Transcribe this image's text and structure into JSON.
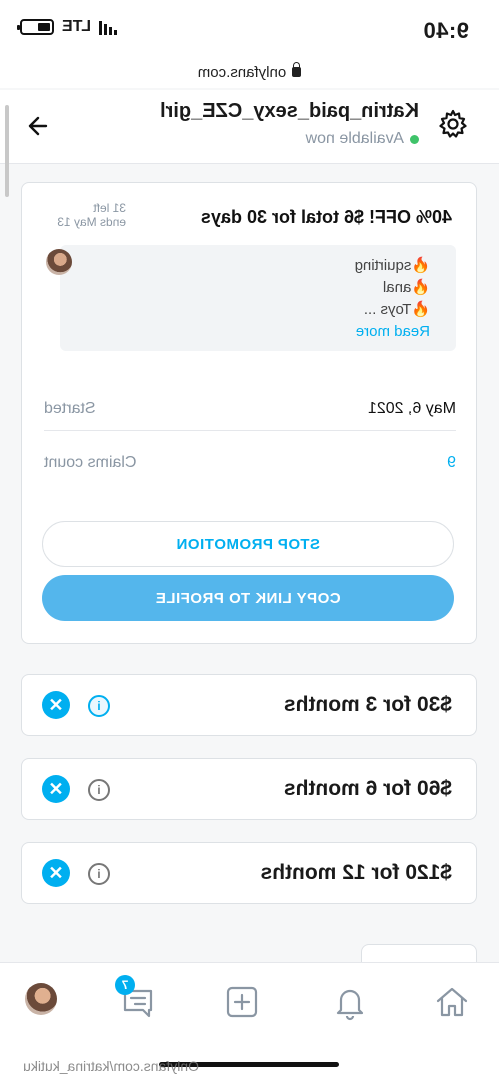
{
  "status_bar": {
    "time": "9:40",
    "network": "LTE"
  },
  "browser": {
    "url": "onlyfans.com"
  },
  "chat_header": {
    "name": "Katrin_paid_sexy_CZE_girl",
    "status": "Available now"
  },
  "promotion": {
    "title": "40% OFF! $6 total for 30 days",
    "left": "31 left",
    "ends": "ends May 13",
    "description": [
      "🔥squirting",
      "🔥anal",
      "🔥Toys ..."
    ],
    "read_more": "Read more",
    "started_label": "Started",
    "started_value": "May 6, 2021",
    "claims_label": "Claims count",
    "claims_value": "9",
    "stop_button": "STOP PROMOTION",
    "copy_button": "COPY LINK TO PROFILE"
  },
  "bundles": [
    {
      "label": "$30 for 3 months",
      "info_icon": "info-icon"
    },
    {
      "label": "$60 for 6 months",
      "info_icon": "info-icon"
    },
    {
      "label": "$120 for 12 months",
      "info_icon": "info-icon"
    }
  ],
  "bottom_nav": {
    "messages_badge": "7"
  },
  "watermark": "Onlyfans.com/katrina_kutiku",
  "colors": {
    "accent": "#00aff0",
    "button_fill": "#54b6ec",
    "online": "#3fc36a"
  }
}
